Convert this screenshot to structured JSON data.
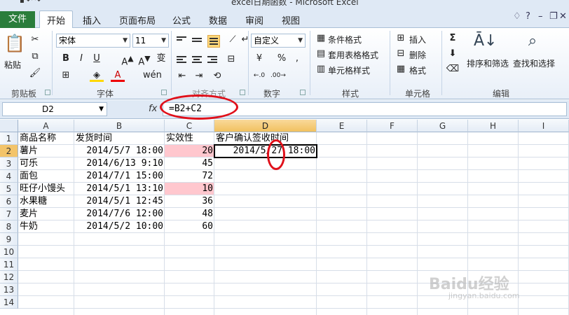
{
  "window": {
    "title": "excel日期函数 - Microsoft Excel"
  },
  "tabs": {
    "file": "文件",
    "items": [
      "开始",
      "插入",
      "页面布局",
      "公式",
      "数据",
      "审阅",
      "视图"
    ]
  },
  "ribbon": {
    "clipboard": {
      "paste": "粘贴",
      "label": "剪贴板"
    },
    "font": {
      "name": "宋体",
      "size": "11",
      "label": "字体",
      "bold": "B",
      "italic": "I",
      "underline": "U"
    },
    "alignment": {
      "label": "对齐方式"
    },
    "number": {
      "format": "自定义",
      "label": "数字",
      "percent": "%",
      "comma": ","
    },
    "styles": {
      "conditional": "条件格式",
      "table": "套用表格格式",
      "cell": "单元格样式",
      "label": "样式"
    },
    "cells": {
      "insert": "插入",
      "delete": "删除",
      "format": "格式",
      "label": "单元格"
    },
    "editing": {
      "sort": "排序和筛选",
      "find": "查找和选择",
      "label": "编辑",
      "sigma": "Σ"
    }
  },
  "formula_bar": {
    "name_box": "D2",
    "fx": "fx",
    "formula": "=B2+C2"
  },
  "sheet": {
    "columns": [
      "A",
      "B",
      "C",
      "D",
      "E",
      "F",
      "G",
      "H",
      "I"
    ],
    "rows": [
      "1",
      "2",
      "3",
      "4",
      "5",
      "6",
      "7",
      "8",
      "9",
      "10",
      "11",
      "12",
      "13",
      "14"
    ],
    "header_row": [
      "商品名称",
      "发货时间",
      "实效性",
      "客户确认签收时间"
    ],
    "data": [
      [
        "薯片",
        "2014/5/7 18:00",
        "20",
        "2014/5/27 18:00"
      ],
      [
        "可乐",
        "2014/6/13 9:10",
        "45",
        ""
      ],
      [
        "面包",
        "2014/7/1 15:00",
        "72",
        ""
      ],
      [
        "旺仔小馒头",
        "2014/5/1 13:10",
        "10",
        ""
      ],
      [
        "水果糖",
        "2014/5/1 12:45",
        "36",
        ""
      ],
      [
        "麦片",
        "2014/7/6 12:00",
        "48",
        ""
      ],
      [
        "牛奶",
        "2014/5/2 10:00",
        "60",
        ""
      ]
    ],
    "highlight_color": "#ffc7ce",
    "selected_cell": "D2"
  },
  "watermark": {
    "brand": "Baidu经验",
    "url": "jingyan.baidu.com"
  },
  "colors": {
    "file_tab": "#2a7d3b",
    "annotation": "#e0101a",
    "header_selected": "#f3c46a"
  }
}
